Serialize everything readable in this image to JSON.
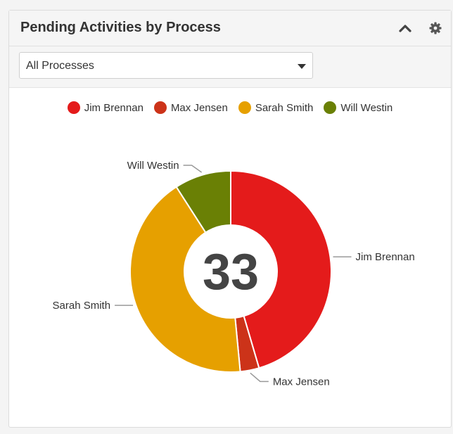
{
  "panel": {
    "title": "Pending Activities by Process",
    "collapse_icon": "chevron-up-icon",
    "settings_icon": "gear-icon"
  },
  "filter": {
    "selected": "All Processes"
  },
  "colors": {
    "jim": "#e41b1b",
    "max": "#cc3319",
    "sarah": "#e6a000",
    "will": "#6a8005"
  },
  "chart_data": {
    "type": "pie",
    "style": "donut",
    "center_label": "33",
    "total": 33,
    "legend_position": "top",
    "slices": [
      {
        "label": "Jim Brennan",
        "value": 15,
        "color": "#e41b1b"
      },
      {
        "label": "Max Jensen",
        "value": 1,
        "color": "#cc3319"
      },
      {
        "label": "Sarah Smith",
        "value": 14,
        "color": "#e6a000"
      },
      {
        "label": "Will Westin",
        "value": 3,
        "color": "#6a8005"
      }
    ]
  }
}
